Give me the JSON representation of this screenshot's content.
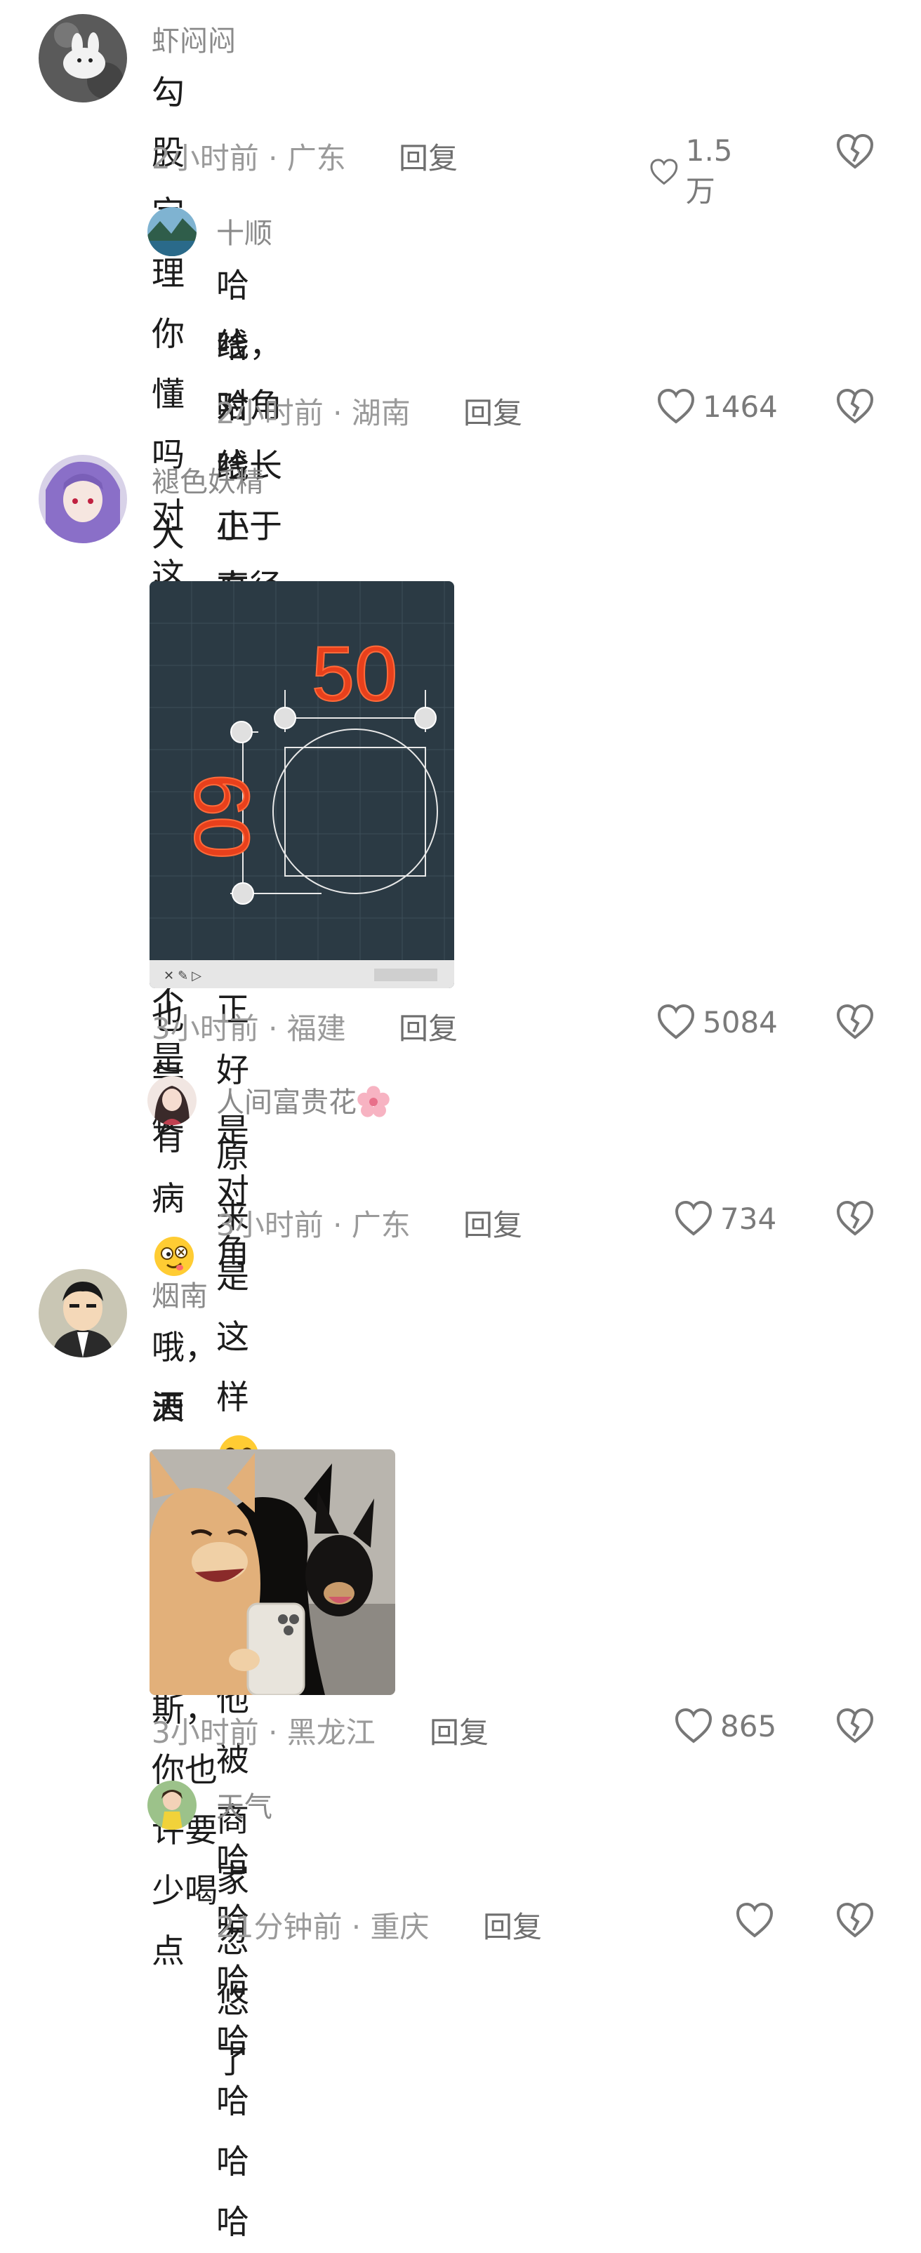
{
  "comments": [
    {
      "username": "虾闷闷",
      "text": "勾股定理你懂吗 对 这次真用的上了 不是梗",
      "time_location": "2小时前 · 广东",
      "reply": "回复",
      "likes": "1.5万"
    },
    {
      "username": "十顺",
      "text_line1": "哈哈哈哈正方体最宽的地方正好是对角",
      "text_line2": "线，对角线长小于直径就能放进去啦",
      "time_location": "2小时前 · 湖南",
      "reply": "回复",
      "likes": "1464"
    },
    {
      "username": "褪色妖精",
      "text": "大过节的我不赖床也是有病",
      "image_labels": {
        "top": "50",
        "left": "60"
      },
      "time_location": "3小时前 · 福建",
      "reply": "回复",
      "likes": "5084"
    },
    {
      "username": "人间富贵花",
      "text_a": "原来是这样",
      "text_b": "我以为他被商家忽悠了",
      "time_location": "3小时前 · 广东",
      "reply": "回复",
      "likes": "734"
    },
    {
      "username": "烟南",
      "text_line1": "哦，天哪！我的小福尔摩斯，你也许要少喝点",
      "text_line2": "酒了。",
      "time_location": "3小时前 · 黑龙江",
      "reply": "回复",
      "likes": "865"
    },
    {
      "username": "天气",
      "text": "哈哈哈哈哈哈哈",
      "time_location": "21分钟前 · 重庆",
      "reply": "回复",
      "likes": ""
    }
  ],
  "colors": {
    "meta": "#9a9a9a",
    "text": "#1c1c1c",
    "username": "#8a8a8a",
    "cad_bg": "#2b3a44",
    "cad_label": "#e8401c"
  }
}
